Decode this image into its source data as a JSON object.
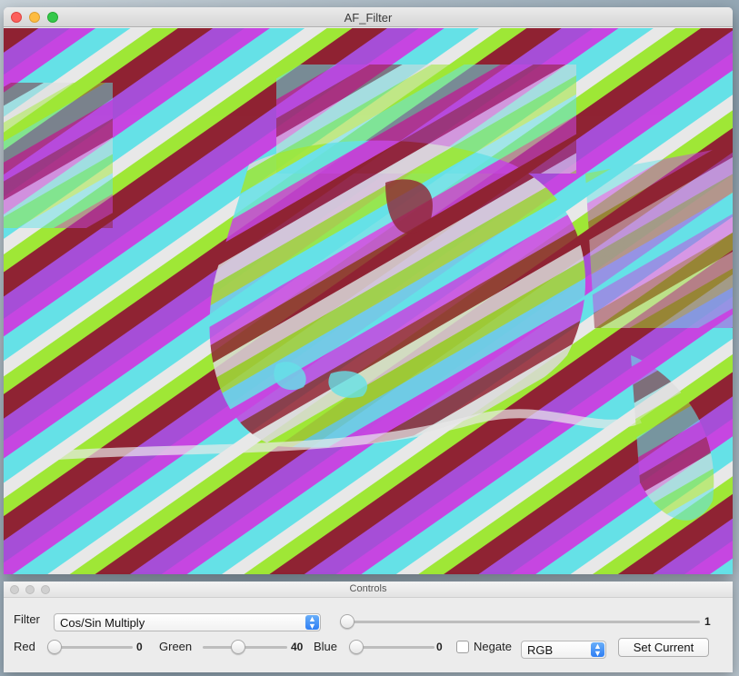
{
  "main_window": {
    "title": "AF_Filter"
  },
  "canvas": {
    "palette": [
      "#8b1a2a",
      "#a347d6",
      "#c43ee0",
      "#5fe0e6",
      "#9be62e",
      "#e8e8e8"
    ]
  },
  "controls": {
    "title": "Controls",
    "filter": {
      "label": "Filter",
      "selected": "Cos/Sin Multiply",
      "amount_value": "1",
      "amount_level": 0.0
    },
    "red": {
      "label": "Red",
      "value": "0",
      "level": 0.0
    },
    "green": {
      "label": "Green",
      "value": "40",
      "level": 0.4
    },
    "blue": {
      "label": "Blue",
      "value": "0",
      "level": 0.0
    },
    "negate": {
      "label": "Negate",
      "checked": false
    },
    "mode": {
      "selected": "RGB"
    },
    "set_current_label": "Set Current"
  }
}
